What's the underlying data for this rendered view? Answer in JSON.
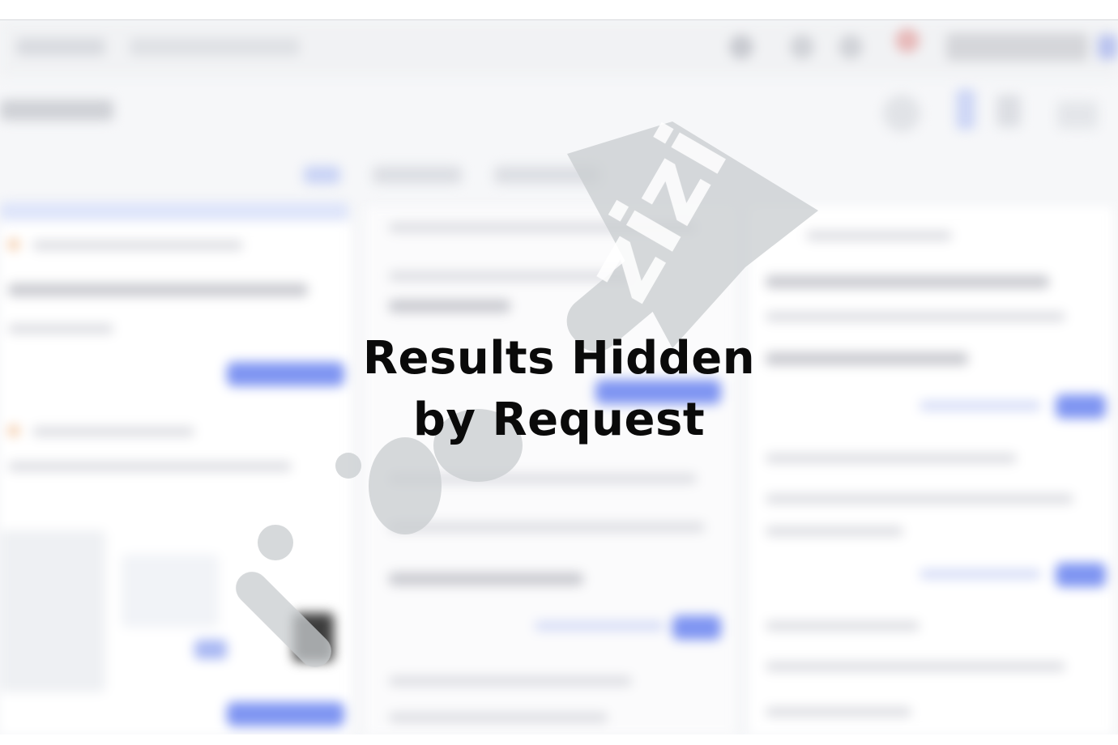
{
  "overlay": {
    "line1": "Results Hidden",
    "line2": "by Request"
  },
  "watermark": {
    "brand": "zizi",
    "icon": "leolizi-watermark-icon"
  },
  "colors": {
    "background": "#f6f7f9",
    "accent": "#7f95f2",
    "text": "#0a0a0a",
    "watermark": "#c9cccf"
  }
}
